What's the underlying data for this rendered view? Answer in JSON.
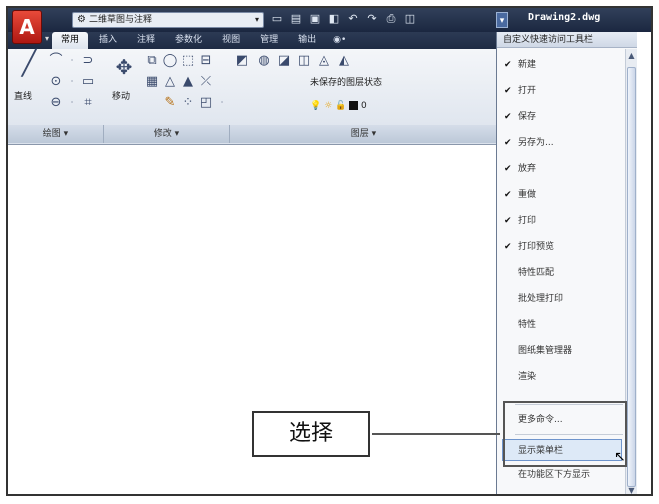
{
  "titlebar": {
    "app_button": "A",
    "workspace": "二维草图与注释",
    "qat_icons": [
      "new-icon",
      "open-icon",
      "save-icon",
      "saveas-icon",
      "undo-icon",
      "redo-icon",
      "print-icon",
      "plot-icon"
    ],
    "doc_title": "Drawing2.dwg"
  },
  "tabs": [
    "常用",
    "插入",
    "注释",
    "参数化",
    "视图",
    "管理",
    "输出"
  ],
  "tab_extra": "◉•",
  "ribbon": {
    "line_label": "直线",
    "move_label": "移动",
    "layer_state": "未保存的图层状态",
    "layer_current": "0",
    "panels": [
      "绘图 ▾",
      "修改 ▾",
      "图层 ▾"
    ]
  },
  "menu": {
    "header": "自定义快速访问工具栏",
    "items": [
      {
        "label": "新建",
        "checked": true
      },
      {
        "label": "打开",
        "checked": true
      },
      {
        "label": "保存",
        "checked": true
      },
      {
        "label": "另存为...",
        "checked": true
      },
      {
        "label": "放弃",
        "checked": true
      },
      {
        "label": "重做",
        "checked": true
      },
      {
        "label": "打印",
        "checked": true
      },
      {
        "label": "打印预览",
        "checked": true
      },
      {
        "label": "特性匹配",
        "checked": false
      },
      {
        "label": "批处理打印",
        "checked": false
      },
      {
        "label": "特性",
        "checked": false
      },
      {
        "label": "图纸集管理器",
        "checked": false
      },
      {
        "label": "渲染",
        "checked": false
      }
    ],
    "more_commands": "更多命令...",
    "show_menubar": "显示菜单栏",
    "show_below": "在功能区下方显示"
  },
  "callout": "选择"
}
